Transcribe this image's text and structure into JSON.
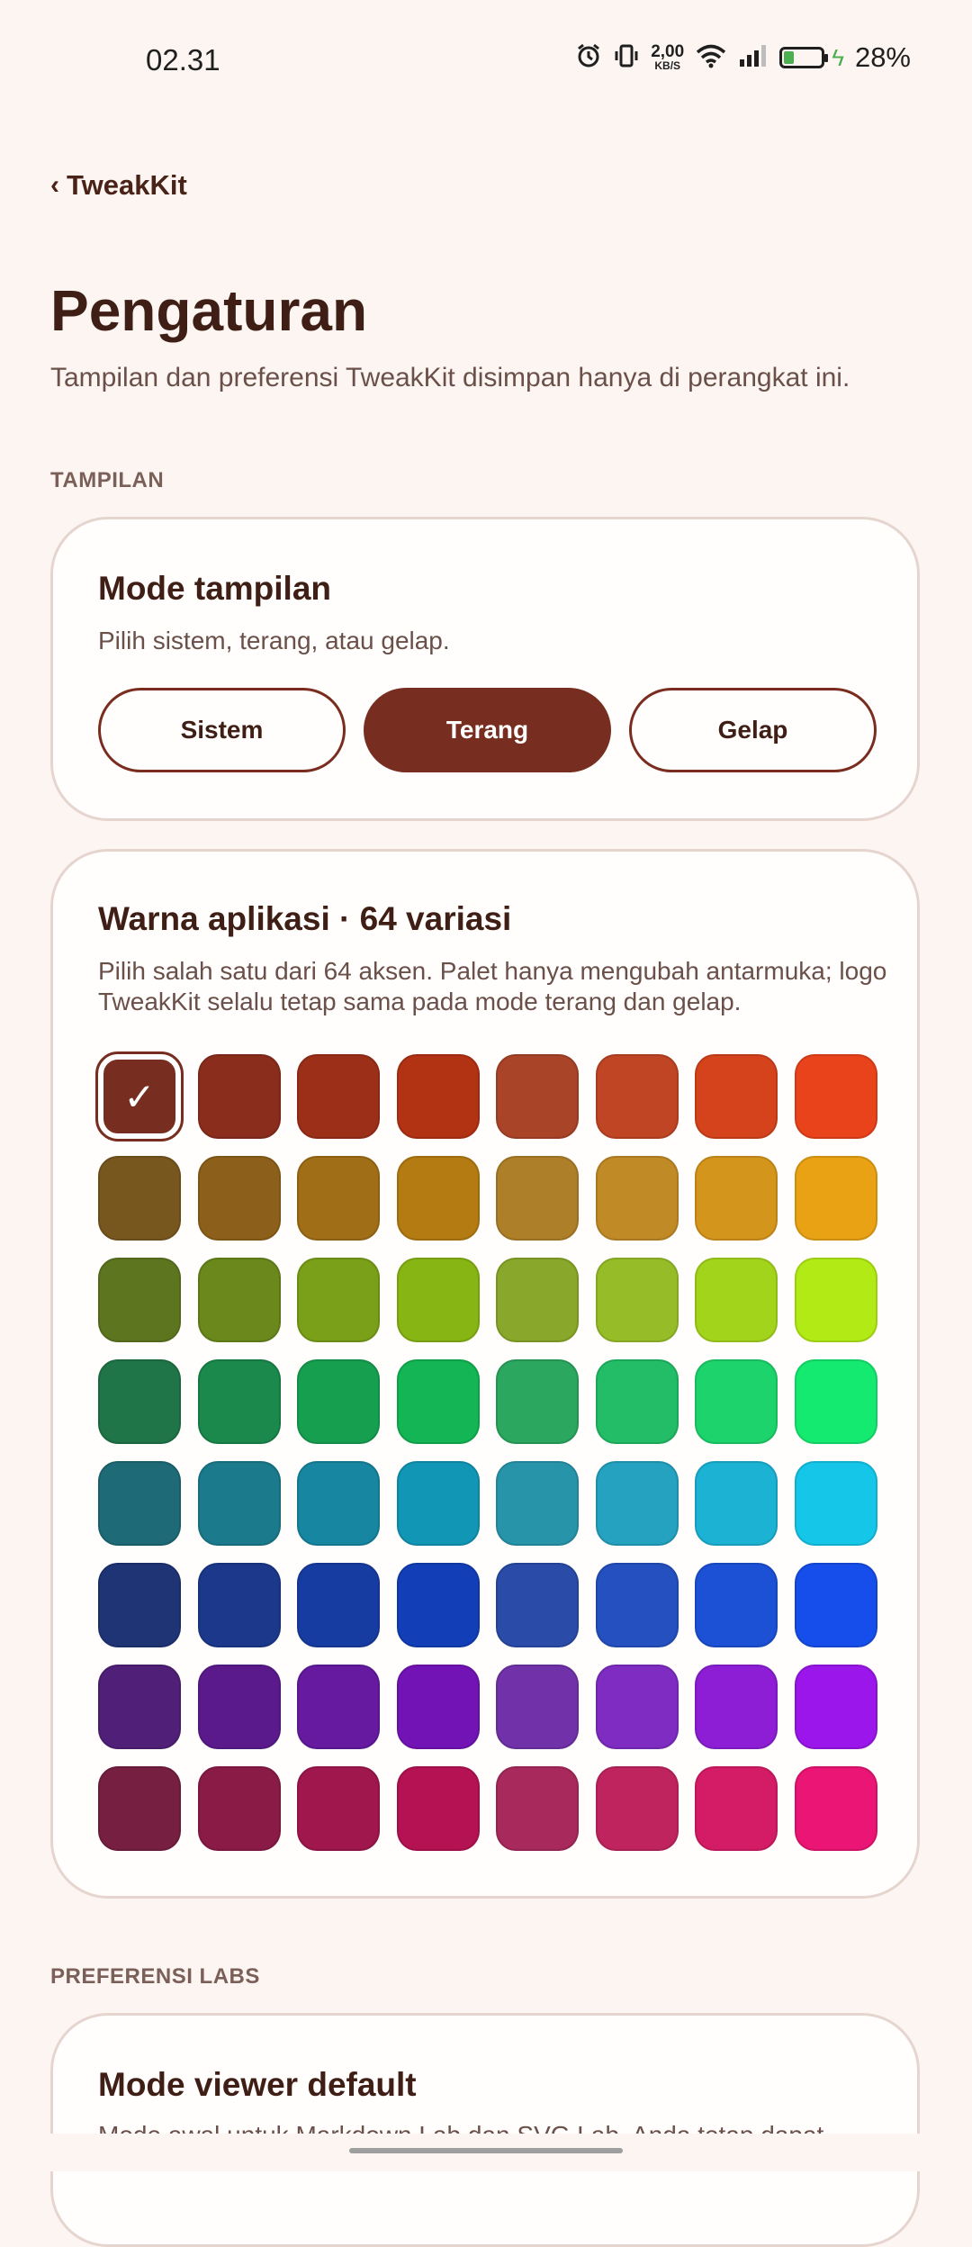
{
  "status_bar": {
    "time": "02.31",
    "net_speed_value": "2,00",
    "net_speed_unit": "KB/S",
    "battery_percent": "28%",
    "battery_level": 0.28,
    "icons": [
      "alarm-icon",
      "vibrate-icon",
      "wifi-icon",
      "signal-icon",
      "battery-icon",
      "charging-icon"
    ]
  },
  "nav": {
    "back_label": "TweakKit"
  },
  "header": {
    "title": "Pengaturan",
    "subtitle": "Tampilan dan preferensi TweakKit disimpan hanya di perangkat ini."
  },
  "sections": {
    "display_label": "TAMPILAN",
    "labs_label": "PREFERENSI LABS"
  },
  "display_mode": {
    "title": "Mode tampilan",
    "description": "Pilih sistem, terang, atau gelap.",
    "options": [
      "Sistem",
      "Terang",
      "Gelap"
    ],
    "selected": "Terang"
  },
  "app_color": {
    "title": "Warna aplikasi · 64 variasi",
    "description": "Pilih salah satu dari 64 aksen. Palet hanya mengubah antarmuka; logo TweakKit selalu tetap sama pada mode terang dan gelap.",
    "selected_index": 0,
    "check_glyph": "✓",
    "swatches": [
      [
        "#772e20",
        "#8a2d1c",
        "#9c2f18",
        "#b23214",
        "#a94428",
        "#c04524",
        "#d4431c",
        "#e9431b"
      ],
      [
        "#77571e",
        "#8c601a",
        "#a06e16",
        "#b37b12",
        "#ad7f28",
        "#c08a26",
        "#d4951c",
        "#e8a214"
      ],
      [
        "#5e7520",
        "#6a881c",
        "#79a018",
        "#86b514",
        "#89a72a",
        "#96bd28",
        "#a3d41c",
        "#b1ea14"
      ],
      [
        "#1f7547",
        "#1b884c",
        "#179f50",
        "#13b554",
        "#2ba75f",
        "#22bd66",
        "#1dd36c",
        "#15ea70"
      ],
      [
        "#1e6a77",
        "#1b7a8c",
        "#1786a0",
        "#1296b5",
        "#2894aa",
        "#24a2c0",
        "#1cb2d4",
        "#15c6e9"
      ],
      [
        "#1f3475",
        "#1b388b",
        "#173ca1",
        "#123fb7",
        "#2a4ca8",
        "#2450c0",
        "#1c51d6",
        "#154eea"
      ],
      [
        "#501f77",
        "#5b1a8c",
        "#661aa0",
        "#7213b5",
        "#7131a9",
        "#7f2cc2",
        "#8d1ed6",
        "#9b16ea"
      ],
      [
        "#761f41",
        "#8a1b47",
        "#9f174d",
        "#b41252",
        "#a8295c",
        "#c0245f",
        "#d41c66",
        "#ea1574"
      ]
    ]
  },
  "labs": {
    "viewer_title": "Mode viewer default",
    "viewer_desc": "Mode awal untuk Markdown Lab dan SVG Lab. Anda tetap dapat"
  }
}
